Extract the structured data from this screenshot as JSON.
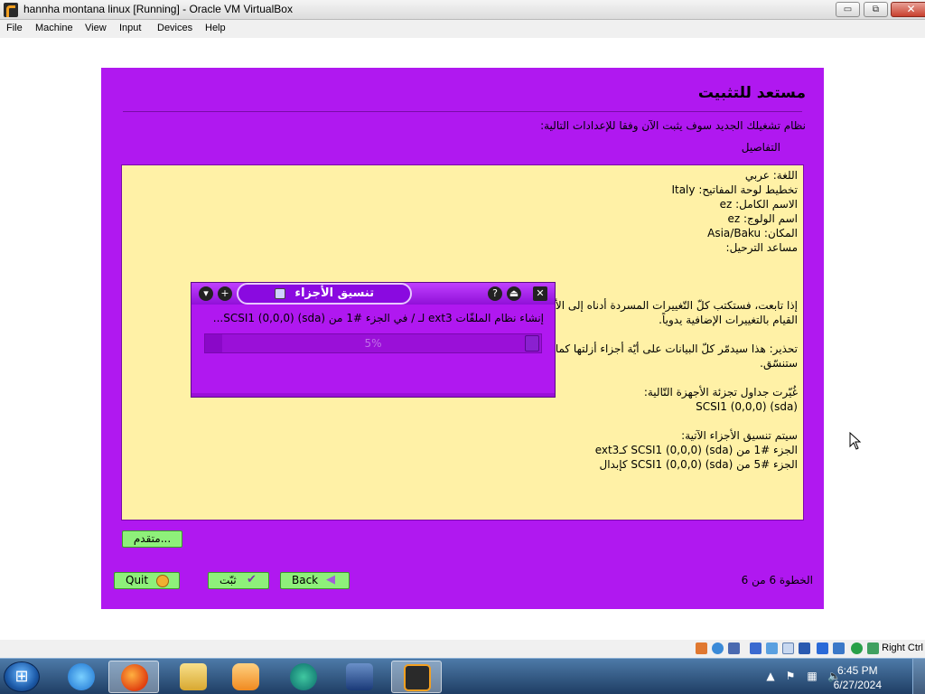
{
  "window": {
    "title": "hannha montana linux [Running] - Oracle VM VirtualBox",
    "minimize": "▭",
    "restore": "⧉",
    "close": "✕"
  },
  "menu": [
    "File",
    "Machine",
    "View",
    "Input",
    "Devices",
    "Help"
  ],
  "installer": {
    "heading": "مستعد للتثبيت",
    "subtitle": "نظام تشغيلك الجديد سوف يثبت الآن وفقا للإعدادات التالية:",
    "details_label": "التفاصيل",
    "summary_lines": [
      "اللغة: عربي",
      "تخطيط لوحة المفاتيح: Italy",
      "الاسم الكامل: ez",
      "اسم الولوج: ez",
      "المكان: Asia/Baku",
      "مساعد الترحيل:",
      "إذا تابعت، فستكتب كلّ التّغييرات المسردة أدناه إلى الأ",
      "القيام بالتغييرات الإضافية يدوياً.",
      "تحذير: هذا سيدمّر كلّ البيانات على أيّة أجزاء أزلتها كما",
      "ستنسّق.",
      "غُيّرت جداول تجزئة الأجهزة التّالية:",
      "SCSI1 (0,0,0) (sda)",
      "سيتم تنسيق الأجزاء الآتية:",
      "الجزء #1 من SCSI1 (0,0,0) (sda) كـext3",
      "الجزء #5 من SCSI1 (0,0,0) (sda) كإبدال"
    ],
    "advanced_button": "متقدم...",
    "quit_button": "Quit",
    "install_button": "ثبّت",
    "back_button": "Back",
    "step": "الخطوة 6 من 6"
  },
  "dialog": {
    "title": "تنسيق الأجزاء",
    "message": "إنشاء نظام الملفّات ext3 لـ / في الجزء #1 من SCSI1 (0,0,0) (sda)...",
    "progress_text": "5%",
    "progress_fraction": 0.05,
    "btn_menu": "▾",
    "btn_plus": "+",
    "btn_help": "?",
    "btn_shade": "⏏",
    "btn_close": "✕"
  },
  "statusbar": {
    "host_key": "Right Ctrl"
  },
  "taskbar": {
    "time": "6:45 PM",
    "date": "6/27/2024"
  },
  "colors": {
    "vm_background": "#b018f0",
    "summary_background": "#fff1a6",
    "button_green": "#8ef07a"
  }
}
